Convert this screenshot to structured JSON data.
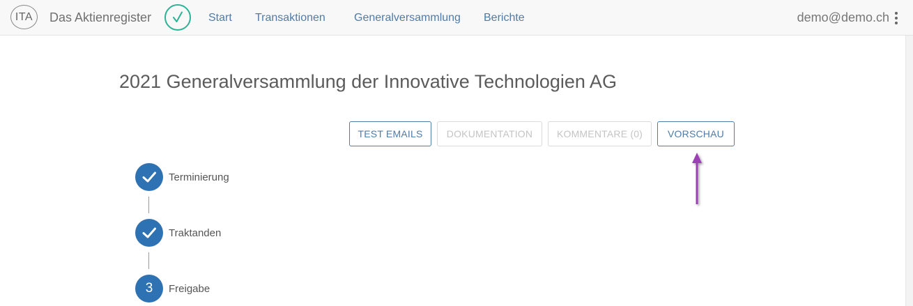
{
  "header": {
    "logo_text": "ITA",
    "app_name": "Das Aktienregister",
    "nav": [
      "Start",
      "Transaktionen",
      "Generalversammlung",
      "Berichte"
    ],
    "user_email": "demo@demo.ch"
  },
  "main": {
    "title": "2021 Generalversammlung der Innovative Technologien AG",
    "buttons": [
      {
        "label": "TEST EMAILS",
        "enabled": true
      },
      {
        "label": "DOKUMENTATION",
        "enabled": false
      },
      {
        "label": "KOMMENTARE (0)",
        "enabled": false
      },
      {
        "label": "VORSCHAU",
        "enabled": true
      }
    ],
    "steps": [
      {
        "label": "Terminierung",
        "status": "done"
      },
      {
        "label": "Traktanden",
        "status": "done"
      },
      {
        "label": "Freigabe",
        "status": "current",
        "number": "3"
      }
    ]
  },
  "colors": {
    "accent": "#2e72b3",
    "link": "#4f7ba8",
    "check": "#2bb395",
    "annotation_arrow": "#9b3fb5"
  }
}
